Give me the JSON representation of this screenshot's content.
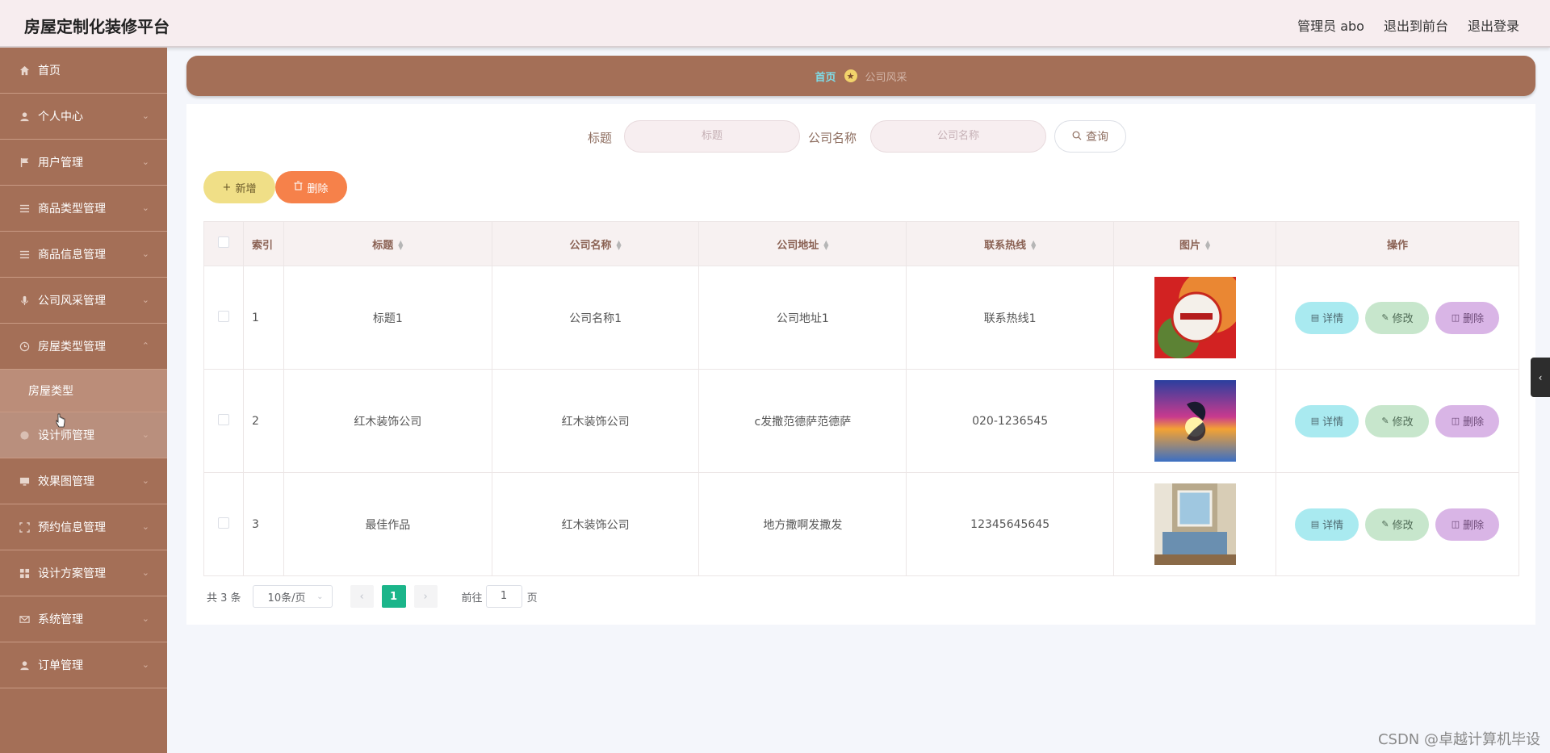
{
  "header": {
    "title": "房屋定制化装修平台",
    "admin_label": "管理员 abo",
    "to_front_label": "退出到前台",
    "logout_label": "退出登录"
  },
  "sidebar": {
    "items": [
      {
        "label": "首页",
        "icon": "home-icon"
      },
      {
        "label": "个人中心",
        "icon": "user-icon"
      },
      {
        "label": "用户管理",
        "icon": "flag-icon"
      },
      {
        "label": "商品类型管理",
        "icon": "menu-icon"
      },
      {
        "label": "商品信息管理",
        "icon": "menu-icon"
      },
      {
        "label": "公司风采管理",
        "icon": "mic-icon"
      },
      {
        "label": "房屋类型管理",
        "icon": "clock-icon"
      },
      {
        "label": "房屋类型",
        "icon": ""
      },
      {
        "label": "设计师管理",
        "icon": "circle-icon"
      },
      {
        "label": "效果图管理",
        "icon": "monitor-icon"
      },
      {
        "label": "预约信息管理",
        "icon": "fullscreen-icon"
      },
      {
        "label": "设计方案管理",
        "icon": "grid-icon"
      },
      {
        "label": "系统管理",
        "icon": "mail-icon"
      },
      {
        "label": "订单管理",
        "icon": "person-icon"
      }
    ]
  },
  "breadcrumb": {
    "home": "首页",
    "current": "公司风采"
  },
  "search": {
    "title_label": "标题",
    "title_placeholder": "标题",
    "company_label": "公司名称",
    "company_placeholder": "公司名称",
    "query_label": "查询"
  },
  "actions": {
    "add_label": "新增",
    "delete_label": "删除"
  },
  "table": {
    "headers": [
      "索引",
      "标题",
      "公司名称",
      "公司地址",
      "联系热线",
      "图片",
      "操作"
    ],
    "rows": [
      {
        "index": "1",
        "title": "标题1",
        "company": "公司名称1",
        "address": "公司地址1",
        "phone": "联系热线1"
      },
      {
        "index": "2",
        "title": "红木装饰公司",
        "company": "红木装饰公司",
        "address": "c发撒范德萨范德萨",
        "phone": "020-1236545"
      },
      {
        "index": "3",
        "title": "最佳作品",
        "company": "红木装饰公司",
        "address": "地方撒啊发撒发",
        "phone": "12345645645"
      }
    ],
    "op_labels": {
      "detail": "详情",
      "edit": "修改",
      "delete": "删除"
    }
  },
  "pagination": {
    "total_text": "共 3 条",
    "page_size": "10条/页",
    "current_page": "1",
    "goto_label": "前往",
    "goto_value": "1",
    "page_suffix": "页"
  },
  "watermark": "CSDN @卓越计算机毕设",
  "colors": {
    "sidebar": "#a46f57",
    "header_bg": "#f7edef",
    "accent_green": "#1bb58a",
    "add_btn": "#f0df87",
    "delete_btn": "#f6814a"
  }
}
